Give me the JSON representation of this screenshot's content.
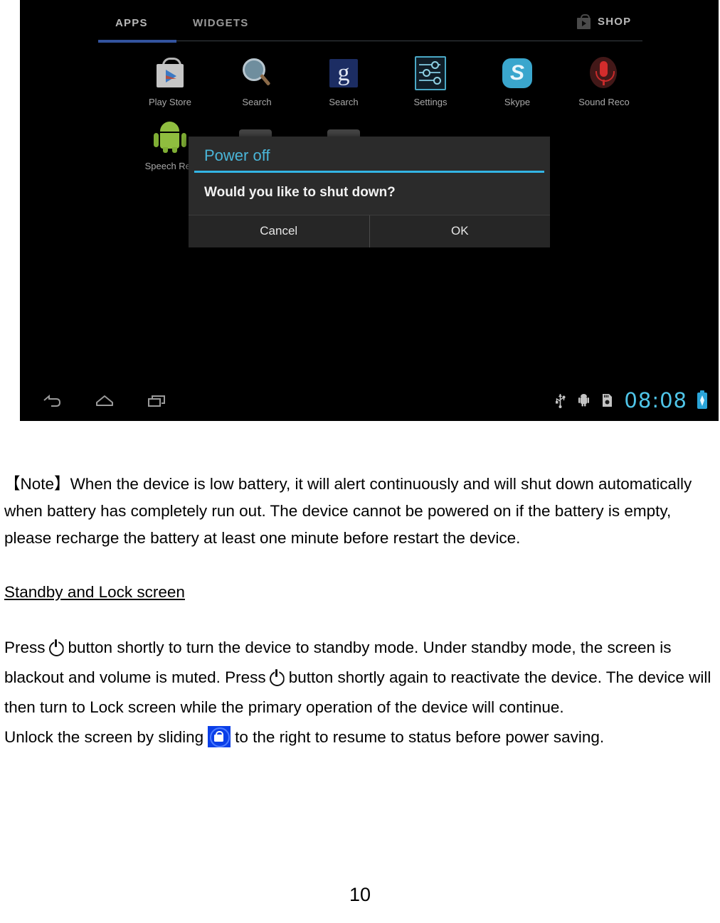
{
  "screenshot": {
    "launcher": {
      "tabs": [
        {
          "label": "APPS",
          "active": true
        },
        {
          "label": "WIDGETS",
          "active": false
        }
      ],
      "shop_label": "SHOP",
      "apps": [
        {
          "label": "Play Store",
          "icon": "play-store-icon"
        },
        {
          "label": "Search",
          "icon": "magnifier-search-icon"
        },
        {
          "label": "Search",
          "icon": "google-search-icon"
        },
        {
          "label": "Settings",
          "icon": "settings-sliders-icon"
        },
        {
          "label": "Skype",
          "icon": "skype-icon"
        },
        {
          "label": "Sound Reco",
          "icon": "sound-recorder-icon"
        },
        {
          "label": "Speech Rec",
          "icon": "android-robot-icon"
        }
      ]
    },
    "dialog": {
      "title": "Power off",
      "message": "Would you like to shut down?",
      "cancel_label": "Cancel",
      "ok_label": "OK",
      "accent_color": "#33b5e5"
    },
    "system_bar": {
      "nav": [
        {
          "name": "back-icon"
        },
        {
          "name": "home-icon"
        },
        {
          "name": "recents-icon"
        }
      ],
      "status_icons": [
        {
          "name": "usb-icon"
        },
        {
          "name": "adb-android-icon"
        },
        {
          "name": "sd-card-icon"
        }
      ],
      "clock": "08:08",
      "clock_color": "#4fc5e8",
      "battery": {
        "name": "battery-charging-icon",
        "color": "#2aa4d8"
      }
    }
  },
  "document": {
    "note": {
      "bracket_open": "【",
      "label": "Note",
      "bracket_close": "】",
      "text": "When the device is low battery, it will alert continuously and will shut down automatically when battery has completely run out.  The device cannot be powered on if the battery is empty, please recharge the battery at least one minute before restart the device."
    },
    "heading": "Standby and Lock screen",
    "body": {
      "seg1": "Press",
      "seg2": "button shortly to turn the device to standby mode.   Under standby mode, the screen is blackout and volume is muted.    Press",
      "seg3": "button shortly again to reactivate the device.     The device will then turn to Lock screen while the primary operation of the device will continue.",
      "seg4": "Unlock the screen by sliding",
      "seg5": "to the right to resume to status before power saving."
    },
    "page_number": "10"
  }
}
